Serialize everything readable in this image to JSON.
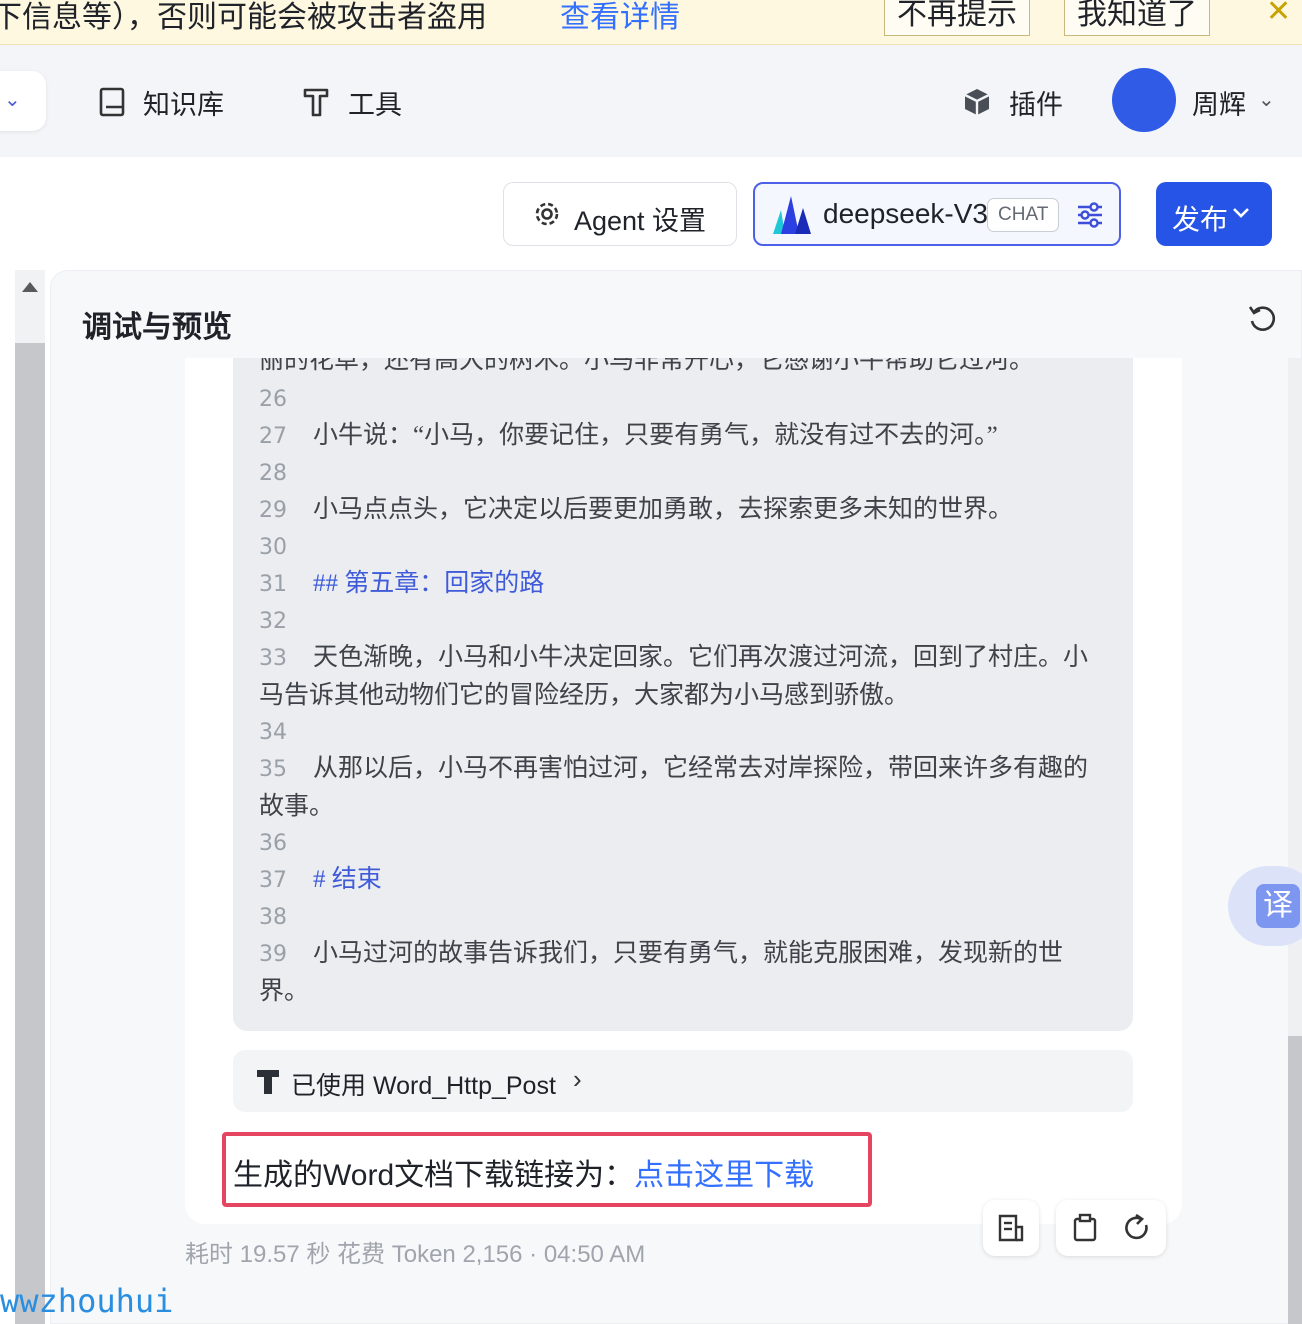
{
  "banner": {
    "message": "下信息等），否则可能会被攻击者盗用",
    "link": "查看详情",
    "dismiss": "不再提示",
    "ack": "我知道了"
  },
  "nav": {
    "knowledge": "知识库",
    "tools": "工具",
    "plugins": "插件",
    "user": "周辉"
  },
  "toolbar": {
    "agent_settings": "Agent 设置",
    "model_name": "deepseek-V3",
    "model_tag": "CHAT",
    "publish": "发布"
  },
  "panel": {
    "title": "调试与预览"
  },
  "code": {
    "lines": [
      {
        "num": "",
        "text": "丽的花草，还有高大的树木。小马非常开心，它感谢小牛帮助它过河。",
        "style": "plain"
      },
      {
        "num": "26",
        "text": "",
        "style": "plain"
      },
      {
        "num": "27",
        "text": "小牛说：“小马，你要记住，只要有勇气，就没有过不去的河。”",
        "style": "plain"
      },
      {
        "num": "28",
        "text": "",
        "style": "plain"
      },
      {
        "num": "29",
        "text": "小马点点头，它决定以后要更加勇敢，去探索更多未知的世界。",
        "style": "plain"
      },
      {
        "num": "30",
        "text": "",
        "style": "plain"
      },
      {
        "num": "31",
        "text": "## 第五章：回家的路",
        "style": "md"
      },
      {
        "num": "32",
        "text": "",
        "style": "plain"
      },
      {
        "num": "33",
        "text": "天色渐晚，小马和小牛决定回家。它们再次渡过河流，回到了村庄。小马告诉其他动物们它的冒险经历，大家都为小马感到骄傲。",
        "style": "plain"
      },
      {
        "num": "34",
        "text": "",
        "style": "plain"
      },
      {
        "num": "35",
        "text": "从那以后，小马不再害怕过河，它经常去对岸探险，带回来许多有趣的故事。",
        "style": "plain"
      },
      {
        "num": "36",
        "text": "",
        "style": "plain"
      },
      {
        "num": "37",
        "text": "# 结束",
        "style": "md"
      },
      {
        "num": "38",
        "text": "",
        "style": "plain"
      },
      {
        "num": "39",
        "text": "小马过河的故事告诉我们，只要有勇气，就能克服困难，发现新的世界。",
        "style": "plain"
      }
    ]
  },
  "tool_call": {
    "label": "已使用 Word_Http_Post"
  },
  "answer": {
    "prefix": "生成的Word文档下载链接为：",
    "link": "点击这里下载"
  },
  "meta": {
    "text": "耗时 19.57 秒   花费 Token 2,156   ·   04:50 AM"
  },
  "translate": {
    "label": "译"
  },
  "watermark": "wwzhouhui",
  "colors": {
    "accent": "#2654e6",
    "link": "#3370ff",
    "highlight_border": "#e64561",
    "banner_bg": "#fff8e0"
  }
}
